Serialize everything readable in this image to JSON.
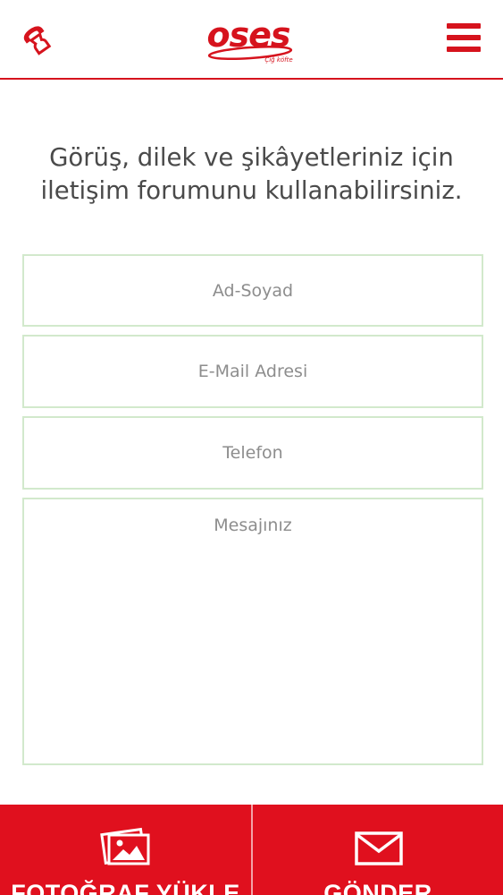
{
  "header": {
    "logo_text": "oses",
    "logo_subtext": "Çiğ köfte",
    "phone_icon": "phone-icon",
    "menu_icon": "hamburger-menu-icon"
  },
  "intro_text": "Görüş, dilek ve şikâyetleriniz için iletişim forumunu kullanabilirsiniz.",
  "form": {
    "name_placeholder": "Ad-Soyad",
    "email_placeholder": "E-Mail Adresi",
    "phone_placeholder": "Telefon",
    "message_placeholder": "Mesajınız"
  },
  "bottom_bar": {
    "upload_label": "FOTOĞRAF YÜKLE",
    "upload_icon": "photo-gallery-icon",
    "send_label": "GÖNDER",
    "send_icon": "envelope-icon"
  },
  "colors": {
    "brand_red": "#d6131d",
    "bar_red": "#e0101e",
    "field_border": "#d2e9cc",
    "text_gray": "#4a4a4a",
    "placeholder_gray": "#8d8d8d"
  }
}
